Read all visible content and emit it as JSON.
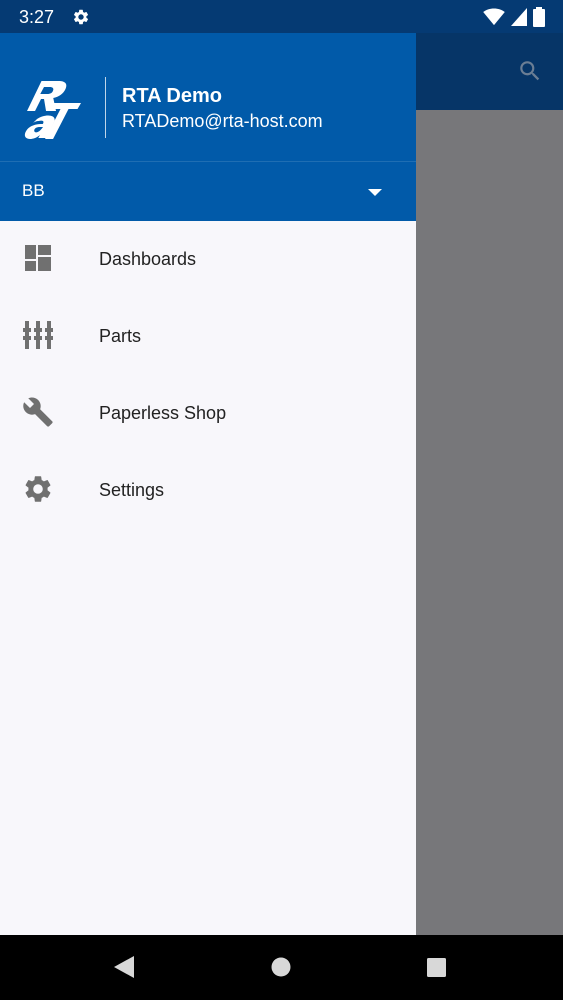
{
  "status_bar": {
    "time": "3:27",
    "icons": [
      "settings-gear-icon",
      "wifi-icon",
      "signal-icon",
      "battery-icon"
    ]
  },
  "account": {
    "name": "RTA Demo",
    "email": "RTADemo@rta-host.com",
    "logo_text": "RTA",
    "selected": "BB"
  },
  "menu": {
    "items": [
      {
        "label": "Dashboards",
        "icon": "dashboard-icon"
      },
      {
        "label": "Parts",
        "icon": "parts-icon"
      },
      {
        "label": "Paperless Shop",
        "icon": "wrench-icon"
      },
      {
        "label": "Settings",
        "icon": "settings-icon"
      }
    ]
  },
  "colors": {
    "header": "#015aa9",
    "status_bar": "#053a73",
    "drawer_bg": "#f8f7fb",
    "scrim": "#77777a",
    "icon_gray": "#707070"
  }
}
